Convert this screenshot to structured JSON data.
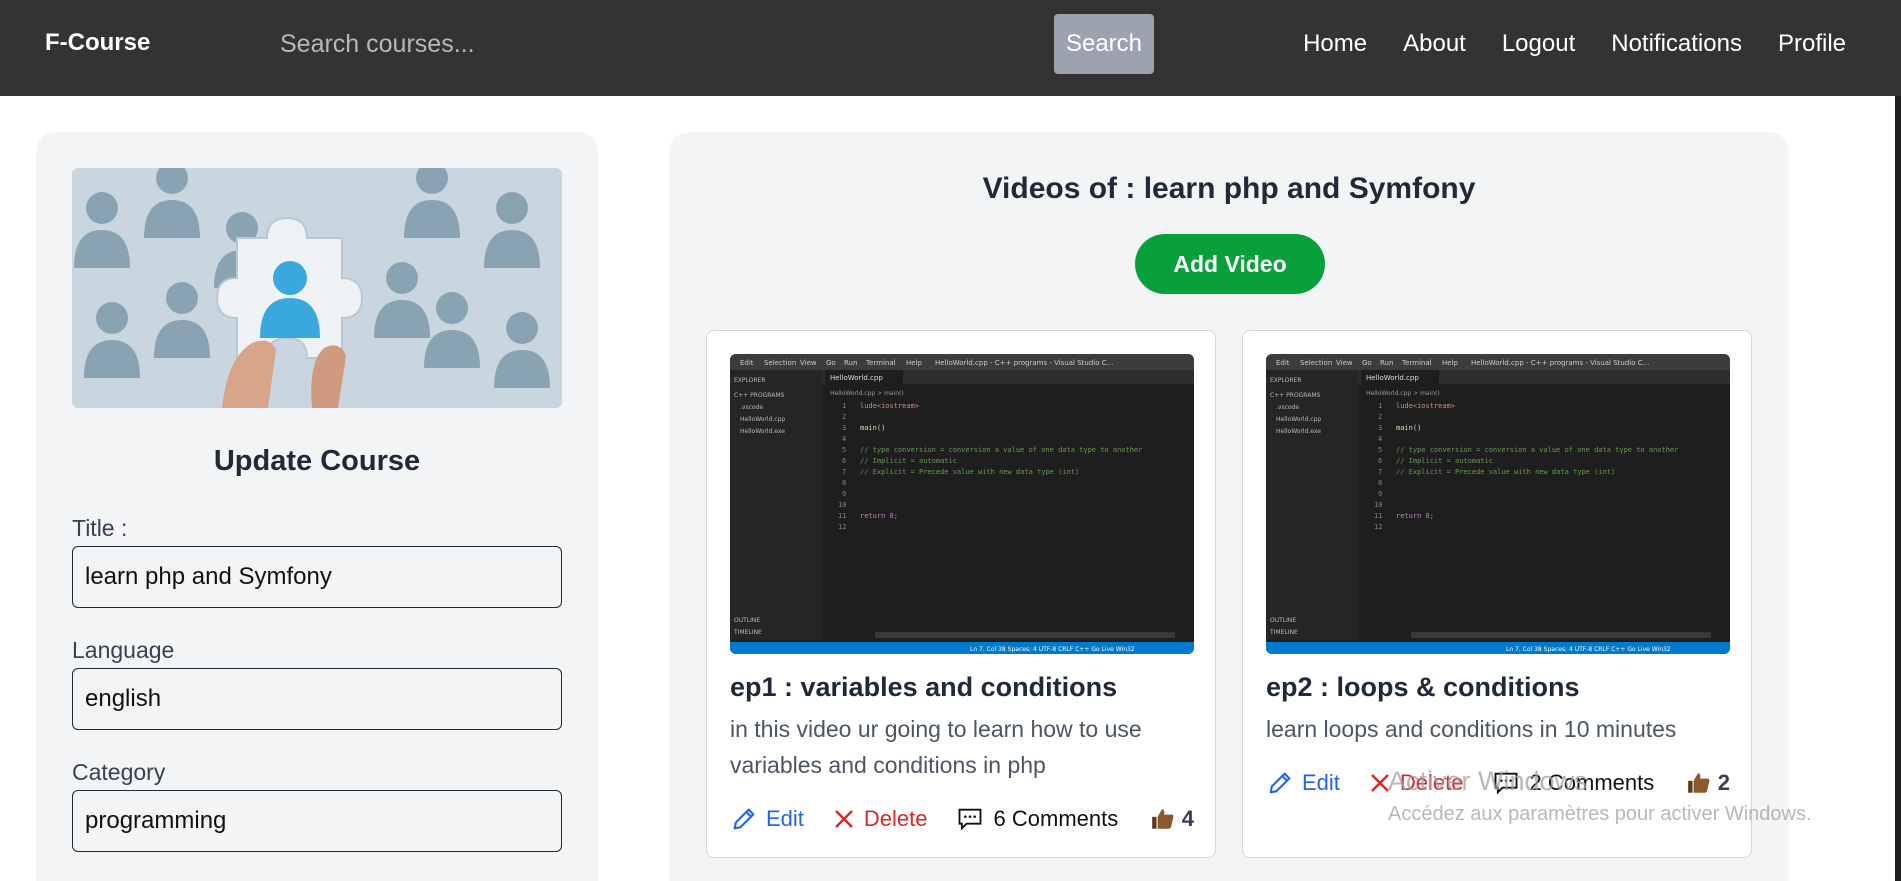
{
  "navbar": {
    "brand": "F-Course",
    "search_placeholder": "Search courses...",
    "search_button": "Search",
    "links": [
      "Home",
      "About",
      "Logout",
      "Notifications",
      "Profile"
    ]
  },
  "update_form": {
    "title": "Update Course",
    "title_label": "Title :",
    "title_value": "learn php and Symfony",
    "language_label": "Language",
    "language_value": "english",
    "category_label": "Category",
    "category_value": "programming"
  },
  "videos": {
    "heading": "Videos of : learn php and Symfony",
    "add_button": "Add Video",
    "items": [
      {
        "title": "ep1 : variables and conditions",
        "description": "in this video ur going to learn how to use variables and conditions in php",
        "edit": "Edit",
        "delete": "Delete",
        "comments": "6 Comments",
        "likes": "4"
      },
      {
        "title": "ep2 : loops & conditions",
        "description": "learn loops and conditions in 10 minutes",
        "edit": "Edit",
        "delete": "Delete",
        "comments": "2 Comments",
        "likes": "2"
      }
    ]
  },
  "editor_thumbnail": {
    "menu": [
      "Edit",
      "Selection",
      "View",
      "Go",
      "Run",
      "Terminal",
      "Help"
    ],
    "window_title": "HelloWorld.cpp - C++ programs - Visual Studio C...",
    "tab": "HelloWorld.cpp",
    "breadcrumb": "HelloWorld.cpp > main()",
    "explorer": [
      "EXPLORER",
      "C++ PROGRAMS",
      ".vscode",
      "HelloWorld.cpp",
      "HelloWorld.exe"
    ],
    "outline": "OUTLINE",
    "timeline": "TIMELINE",
    "code_lines": [
      "lude<iostream>",
      "",
      "main()",
      "",
      "// type conversion = conversion a value of one data type to another",
      "//              Implicit = automatic",
      "//              Explicit = Precede value with new data type (int)",
      "",
      "",
      "",
      "return 0;",
      ""
    ],
    "status": "Ln 7, Col 38   Spaces: 4   UTF-8   CRLF   C++   Go Live   Win32"
  },
  "watermark": {
    "title": "Activer Windows",
    "subtitle": "Accédez aux paramètres pour activer Windows."
  },
  "colors": {
    "navbar": "#333333",
    "add_button": "#08a03a",
    "edit": "#2563eb",
    "delete": "#dc2626",
    "panel": "#f3f4f6"
  }
}
